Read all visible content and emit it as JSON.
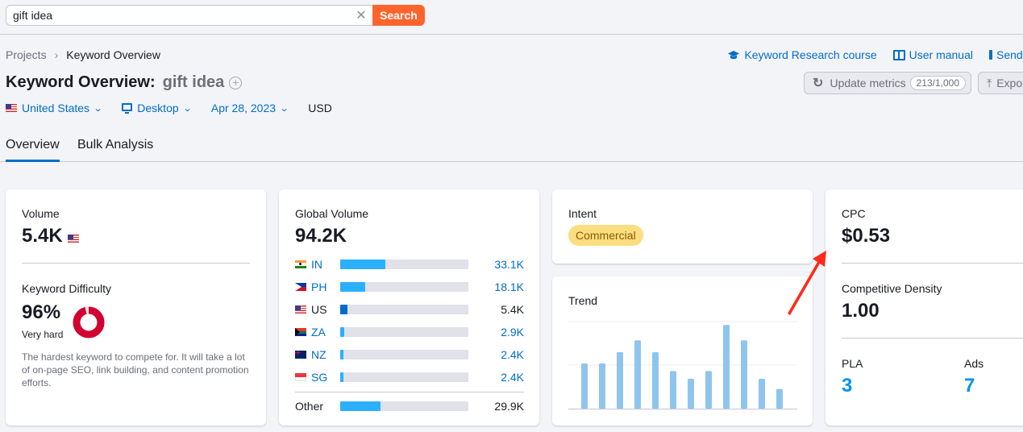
{
  "search": {
    "value": "gift idea",
    "button_label": "Search"
  },
  "breadcrumb": {
    "items": [
      "Projects",
      "Keyword Overview"
    ]
  },
  "header": {
    "title_prefix": "Keyword Overview:",
    "keyword": "gift idea"
  },
  "filters": {
    "country": "United States",
    "device": "Desktop",
    "date": "Apr 28, 2023",
    "currency": "USD"
  },
  "top_links": {
    "course": "Keyword Research course",
    "manual": "User manual",
    "send": "Send feedback"
  },
  "actions": {
    "update_label": "Update metrics",
    "update_count": "213/1,000",
    "export_label": "Export"
  },
  "tabs": [
    {
      "label": "Overview",
      "active": true
    },
    {
      "label": "Bulk Analysis",
      "active": false
    }
  ],
  "volume": {
    "label": "Volume",
    "value": "5.4K"
  },
  "keyword_difficulty": {
    "label": "Keyword Difficulty",
    "value": "96%",
    "percent": 96,
    "level": "Very hard",
    "description": "The hardest keyword to compete for. It will take a lot of on-page SEO, link building, and content promotion efforts.",
    "color": "#d1002f"
  },
  "global_volume": {
    "label": "Global Volume",
    "value": "94.2K",
    "rows": [
      {
        "code": "IN",
        "value": "33.1K",
        "share": 0.351,
        "highlight": false
      },
      {
        "code": "PH",
        "value": "18.1K",
        "share": 0.192,
        "highlight": false
      },
      {
        "code": "US",
        "value": "5.4K",
        "share": 0.057,
        "highlight": true
      },
      {
        "code": "ZA",
        "value": "2.9K",
        "share": 0.031,
        "highlight": false
      },
      {
        "code": "NZ",
        "value": "2.4K",
        "share": 0.025,
        "highlight": false
      },
      {
        "code": "SG",
        "value": "2.4K",
        "share": 0.025,
        "highlight": false
      }
    ],
    "other": {
      "label": "Other",
      "value": "29.9K",
      "share": 0.317
    }
  },
  "intent": {
    "label": "Intent",
    "value": "Commercial"
  },
  "trend": {
    "label": "Trend",
    "values": [
      0.53,
      0.53,
      0.66,
      0.8,
      0.66,
      0.44,
      0.35,
      0.44,
      0.98,
      0.8,
      0.35,
      0.23
    ]
  },
  "cpc": {
    "label": "CPC",
    "value": "$0.53"
  },
  "competitive_density": {
    "label": "Competitive Density",
    "value": "1.00"
  },
  "pla": {
    "label": "PLA",
    "value": "3"
  },
  "ads": {
    "label": "Ads",
    "value": "7"
  },
  "colors": {
    "accent": "#006dca",
    "search_button": "#ff642d",
    "bar_fill": "#2bafff",
    "bar_highlight": "#006dca",
    "trend_bar": "#8fc5ed",
    "annotation_arrow": "#ff2a1a"
  }
}
